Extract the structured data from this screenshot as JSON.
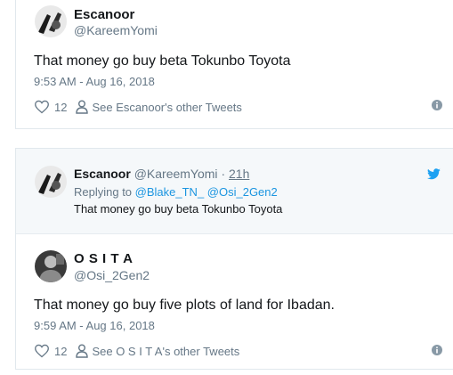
{
  "tweet1": {
    "name": "Escanoor",
    "handle": "@KareemYomi",
    "text": "That money go buy beta Tokunbo Toyota",
    "time": "9:53 AM - Aug 16, 2018",
    "likes": "12",
    "other_tweets": "See Escanoor's other Tweets"
  },
  "tweet2": {
    "quoted": {
      "name": "Escanoor",
      "handle": "@KareemYomi",
      "sep": "·",
      "age": "21h",
      "replying_prefix": "Replying to",
      "mentions": "@Blake_TN_ @Osi_2Gen2",
      "text": "That money go buy beta Tokunbo Toyota"
    },
    "name": "O S I T A",
    "handle": "@Osi_2Gen2",
    "text": "That money go buy five plots of land for Ibadan.",
    "time": "9:59 AM - Aug 16, 2018",
    "likes": "12",
    "other_tweets": "See O S I T A's other Tweets"
  },
  "colors": {
    "link": "#1b95e0",
    "muted": "#657786",
    "border": "#e1e8ed",
    "quoted_bg": "#f5f8fa"
  }
}
